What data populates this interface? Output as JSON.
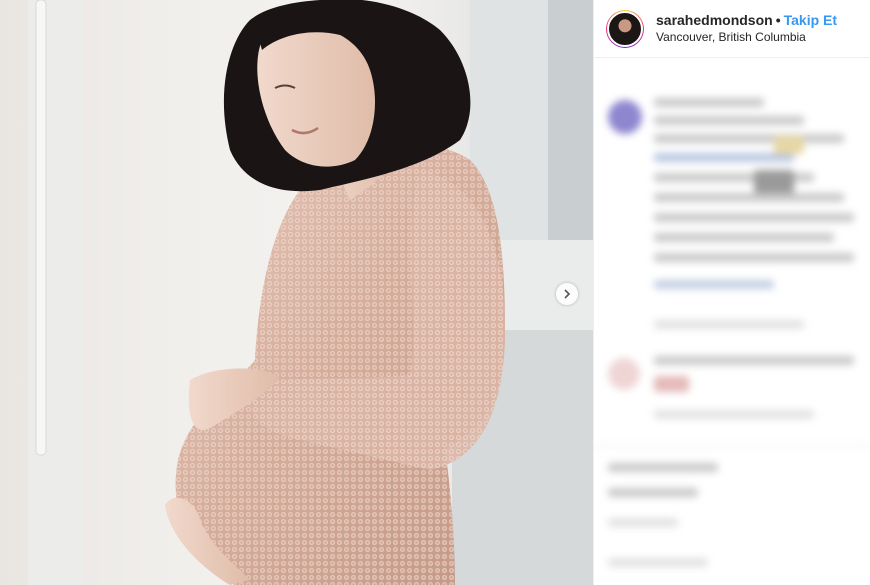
{
  "post": {
    "username": "sarahedmondson",
    "separator": "•",
    "follow_label": "Takip Et",
    "location": "Vancouver, British Columbia"
  },
  "photo": {
    "next_icon": "chevron-right-icon"
  },
  "colors": {
    "follow": "#3897f0",
    "dress": "#d9b3a4",
    "hair": "#1a1514"
  }
}
